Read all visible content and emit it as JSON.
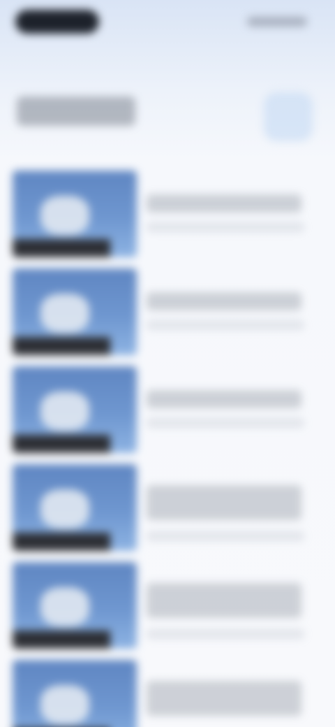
{
  "status_bar": {},
  "header": {
    "title": ""
  },
  "list": {
    "items": [
      {
        "title": "",
        "subtitle": ""
      },
      {
        "title": "",
        "subtitle": ""
      },
      {
        "title": "",
        "subtitle": ""
      },
      {
        "title": "",
        "subtitle": ""
      },
      {
        "title": "",
        "subtitle": ""
      },
      {
        "title": "",
        "subtitle": ""
      }
    ]
  },
  "colors": {
    "background_top": "#d9e4f5",
    "background": "#f8f9fc",
    "thumbnail_sky": "#6f97d0"
  },
  "icons": {
    "header_action": "square-action-icon"
  }
}
